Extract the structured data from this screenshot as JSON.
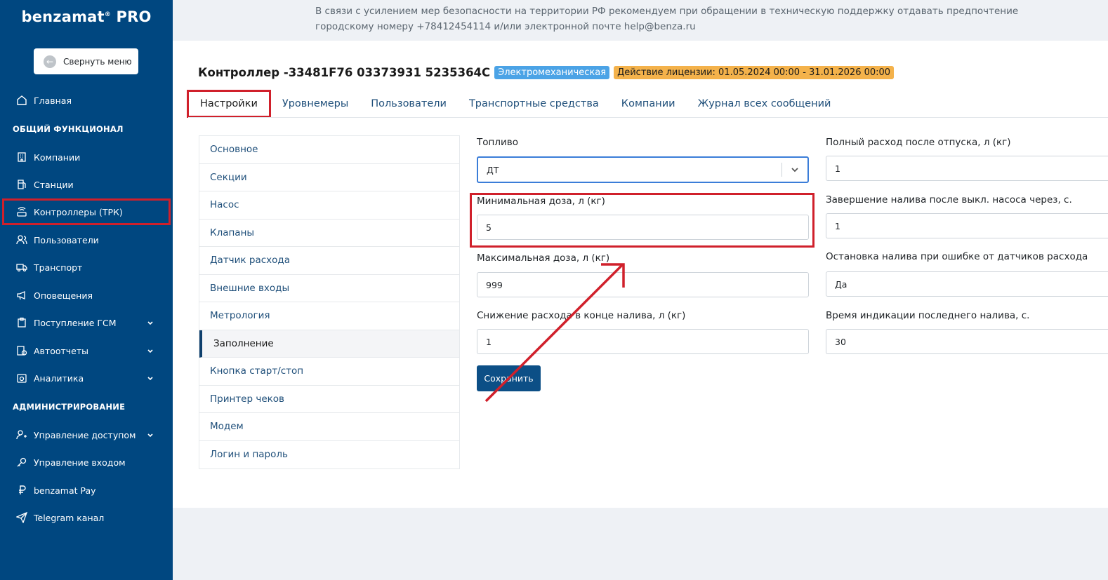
{
  "sidebar": {
    "brand": "benzamat",
    "brand_suffix": "PRO",
    "brand_mark": "®",
    "collapse_label": "Свернуть меню",
    "items": [
      {
        "label": "Главная",
        "icon": "home-icon"
      },
      {
        "label": "Компании",
        "icon": "building-icon"
      },
      {
        "label": "Станции",
        "icon": "fuel-station-icon"
      },
      {
        "label": "Контроллеры (ТРК)",
        "icon": "router-icon"
      },
      {
        "label": "Пользователи",
        "icon": "users-icon"
      },
      {
        "label": "Транспорт",
        "icon": "truck-icon"
      },
      {
        "label": "Оповещения",
        "icon": "megaphone-icon"
      },
      {
        "label": "Поступление ГСМ",
        "icon": "clipboard-icon"
      },
      {
        "label": "Автоотчеты",
        "icon": "report-icon"
      },
      {
        "label": "Аналитика",
        "icon": "analytics-icon"
      },
      {
        "label": "Управление доступом",
        "icon": "user-access-icon"
      },
      {
        "label": "Управление входом",
        "icon": "key-icon"
      },
      {
        "label": "benzamat Pay",
        "icon": "ruble-icon"
      },
      {
        "label": "Telegram канал",
        "icon": "send-icon"
      }
    ],
    "section_general": "ОБЩИЙ ФУНКЦИОНАЛ",
    "section_admin": "АДМИНИСТРИРОВАНИЕ"
  },
  "notice": {
    "text": "В связи с усилением мер безопасности на территории РФ рекомендуем при обращении в техническую поддержку отдавать предпочтение городскому номеру +78412454114 и/или электронной почте help@benza.ru"
  },
  "header": {
    "title": "Контроллер -33481F76 03373931 5235364C",
    "badge_type": "Электромеханическая",
    "badge_license": "Действие лицензии: 01.05.2024 00:00 - 31.01.2026 00:00"
  },
  "tabs": [
    "Настройки",
    "Уровнемеры",
    "Пользователи",
    "Транспортные средства",
    "Компании",
    "Журнал всех сообщений"
  ],
  "submenu": [
    "Основное",
    "Секции",
    "Насос",
    "Клапаны",
    "Датчик расхода",
    "Внешние входы",
    "Метрология",
    "Заполнение",
    "Кнопка старт/стоп",
    "Принтер чеков",
    "Модем",
    "Логин и пароль"
  ],
  "form": {
    "fuel_label": "Топливо",
    "fuel_value": "ДТ",
    "min_dose_label": "Минимальная доза, л (кг)",
    "min_dose_value": "5",
    "max_dose_label": "Максимальная доза, л (кг)",
    "max_dose_value": "999",
    "reduce_label": "Снижение расхода в конце налива, л (кг)",
    "reduce_value": "1",
    "full_flow_label": "Полный расход после отпуска, л (кг)",
    "full_flow_value": "1",
    "finish_label": "Завершение налива после выкл. насоса через, с.",
    "finish_value": "1",
    "stop_label": "Остановка налива при ошибке от датчиков расхода",
    "stop_value": "Да",
    "time_label": "Время индикации последнего налива, с.",
    "time_value": "30",
    "save_label": "Сохранить"
  },
  "colors": {
    "sidebar_bg": "#004780",
    "highlight": "#d0202b",
    "primary_button": "#0c4f86",
    "badge_blue": "#4ba3e6",
    "badge_yellow": "#f4b24b"
  }
}
